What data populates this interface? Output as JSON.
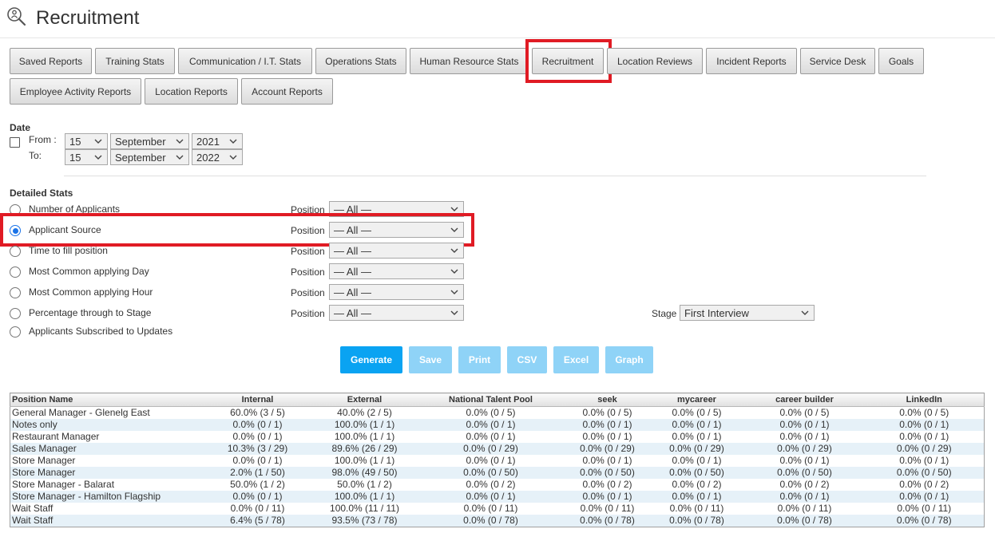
{
  "page": {
    "title": "Recruitment"
  },
  "tabs": [
    {
      "label": "Saved Reports"
    },
    {
      "label": "Training Stats"
    },
    {
      "label": "Communication / I.T. Stats"
    },
    {
      "label": "Operations Stats"
    },
    {
      "label": "Human Resource Stats"
    },
    {
      "label": "Recruitment",
      "active": true
    },
    {
      "label": "Location Reviews"
    },
    {
      "label": "Incident Reports"
    },
    {
      "label": "Service Desk"
    },
    {
      "label": "Goals"
    },
    {
      "label": "Employee Activity Reports"
    },
    {
      "label": "Location Reports"
    },
    {
      "label": "Account Reports"
    }
  ],
  "date": {
    "heading": "Date",
    "from_label": "From :",
    "to_label": "To:",
    "from": {
      "day": "15",
      "month": "September",
      "year": "2021"
    },
    "to": {
      "day": "15",
      "month": "September",
      "year": "2022"
    }
  },
  "detailed": {
    "heading": "Detailed Stats",
    "position_label": "Position",
    "stage_label": "Stage",
    "stage_value": "First Interview",
    "options": [
      {
        "label": "Number of Applicants",
        "position": "— All —"
      },
      {
        "label": "Applicant Source",
        "position": "— All —",
        "selected": true
      },
      {
        "label": "Time to fill position",
        "position": "— All —"
      },
      {
        "label": "Most Common applying Day",
        "position": "— All —"
      },
      {
        "label": "Most Common applying Hour",
        "position": "— All —"
      },
      {
        "label": "Percentage through to Stage",
        "position": "— All —"
      },
      {
        "label": "Applicants Subscribed to Updates"
      }
    ]
  },
  "actions": {
    "generate": "Generate",
    "save": "Save",
    "print": "Print",
    "csv": "CSV",
    "excel": "Excel",
    "graph": "Graph"
  },
  "table": {
    "headers": [
      "Position Name",
      "Internal",
      "External",
      "National Talent Pool",
      "seek",
      "mycareer",
      "career builder",
      "LinkedIn"
    ],
    "rows": [
      [
        "General Manager - Glenelg East",
        "60.0% (3 / 5)",
        "40.0% (2 / 5)",
        "0.0% (0 / 5)",
        "0.0% (0 / 5)",
        "0.0% (0 / 5)",
        "0.0% (0 / 5)",
        "0.0% (0 / 5)"
      ],
      [
        "Notes only",
        "0.0% (0 / 1)",
        "100.0% (1 / 1)",
        "0.0% (0 / 1)",
        "0.0% (0 / 1)",
        "0.0% (0 / 1)",
        "0.0% (0 / 1)",
        "0.0% (0 / 1)"
      ],
      [
        "Restaurant Manager",
        "0.0% (0 / 1)",
        "100.0% (1 / 1)",
        "0.0% (0 / 1)",
        "0.0% (0 / 1)",
        "0.0% (0 / 1)",
        "0.0% (0 / 1)",
        "0.0% (0 / 1)"
      ],
      [
        "Sales Manager",
        "10.3% (3 / 29)",
        "89.6% (26 / 29)",
        "0.0% (0 / 29)",
        "0.0% (0 / 29)",
        "0.0% (0 / 29)",
        "0.0% (0 / 29)",
        "0.0% (0 / 29)"
      ],
      [
        "Store Manager",
        "0.0% (0 / 1)",
        "100.0% (1 / 1)",
        "0.0% (0 / 1)",
        "0.0% (0 / 1)",
        "0.0% (0 / 1)",
        "0.0% (0 / 1)",
        "0.0% (0 / 1)"
      ],
      [
        "Store Manager",
        "2.0% (1 / 50)",
        "98.0% (49 / 50)",
        "0.0% (0 / 50)",
        "0.0% (0 / 50)",
        "0.0% (0 / 50)",
        "0.0% (0 / 50)",
        "0.0% (0 / 50)"
      ],
      [
        "Store Manager - Balarat",
        "50.0% (1 / 2)",
        "50.0% (1 / 2)",
        "0.0% (0 / 2)",
        "0.0% (0 / 2)",
        "0.0% (0 / 2)",
        "0.0% (0 / 2)",
        "0.0% (0 / 2)"
      ],
      [
        "Store Manager - Hamilton Flagship",
        "0.0% (0 / 1)",
        "100.0% (1 / 1)",
        "0.0% (0 / 1)",
        "0.0% (0 / 1)",
        "0.0% (0 / 1)",
        "0.0% (0 / 1)",
        "0.0% (0 / 1)"
      ],
      [
        "Wait Staff",
        "0.0% (0 / 11)",
        "100.0% (11 / 11)",
        "0.0% (0 / 11)",
        "0.0% (0 / 11)",
        "0.0% (0 / 11)",
        "0.0% (0 / 11)",
        "0.0% (0 / 11)"
      ],
      [
        "Wait Staff",
        "6.4% (5 / 78)",
        "93.5% (73 / 78)",
        "0.0% (0 / 78)",
        "0.0% (0 / 78)",
        "0.0% (0 / 78)",
        "0.0% (0 / 78)",
        "0.0% (0 / 78)"
      ]
    ]
  },
  "colors": {
    "accent": "#0aa3f2",
    "accent_disabled": "#8fd3f7",
    "highlight": "#e01b24",
    "row_alt": "#e6f1f8"
  },
  "icons": {
    "logo": "recruitment-person-search-icon",
    "select": "chevron-down-icon"
  }
}
